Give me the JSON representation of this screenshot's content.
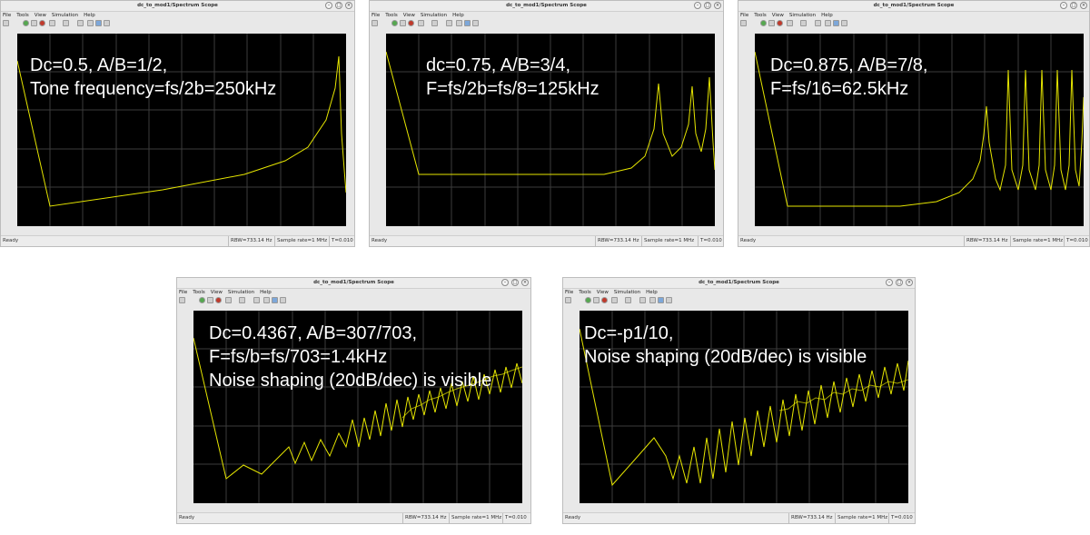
{
  "common": {
    "title": "dc_to_mod1/Spectrum Scope",
    "menu": [
      "File",
      "Tools",
      "View",
      "Simulation",
      "Help"
    ],
    "status": {
      "ready": "Ready",
      "rbw": "RBW=733.14 Hz",
      "rate": "Sample rate=1 MHz",
      "time": "T=0.010"
    },
    "window_buttons": [
      "–",
      "□",
      "×"
    ]
  },
  "colors": {
    "trace": "#e6e600",
    "grid": "#3c3c3c",
    "plot_bg": "#000000"
  },
  "windows": [
    {
      "annotation": [
        "Dc=0.5, A/B=1/2,",
        "Tone frequency=fs/2b=250kHz"
      ]
    },
    {
      "annotation": [
        "dc=0.75, A/B=3/4,",
        "F=fs/2b=fs/8=125kHz"
      ]
    },
    {
      "annotation": [
        "Dc=0.875, A/B=7/8,",
        "F=fs/16=62.5kHz"
      ]
    },
    {
      "annotation": [
        "Dc=0.4367, A/B=307/703,",
        "F=fs/b=fs/703=1.4kHz",
        "Noise shaping (20dB/dec) is visible"
      ]
    },
    {
      "annotation": [
        "Dc=-p1/10,",
        "Noise shaping (20dB/dec) is visible"
      ]
    }
  ],
  "icons": [
    "print-icon",
    "run-icon",
    "step-icon",
    "stop-icon",
    "highlight-icon",
    "zoom-icon",
    "axes-icon",
    "scale-icon",
    "settings-icon",
    "cursor-icon"
  ]
}
